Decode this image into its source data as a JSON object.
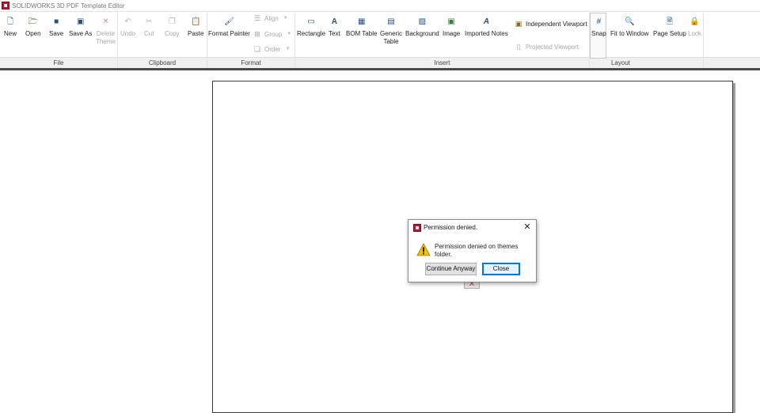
{
  "window": {
    "title": "SOLIDWORKS 3D PDF Template Editor"
  },
  "ribbon": {
    "file": {
      "label": "File",
      "new": "New",
      "open": "Open",
      "save": "Save",
      "save_as": "Save As",
      "delete_theme_line1": "Delete",
      "delete_theme_line2": "Theme"
    },
    "clipboard": {
      "label": "Clipboard",
      "undo": "Undo",
      "cut": "Cut",
      "copy": "Copy",
      "paste": "Paste"
    },
    "format": {
      "label": "Format",
      "format_painter": "Format Painter",
      "align": "Align",
      "group": "Group",
      "order": "Order"
    },
    "insert": {
      "label": "Insert",
      "rectangle": "Rectangle",
      "text": "Text",
      "bom_table": "BOM Table",
      "generic_table_line1": "Generic",
      "generic_table_line2": "Table",
      "background": "Background",
      "image": "Image",
      "imported_notes": "Imported Notes",
      "independent_viewport": "Independent Viewport",
      "projected_viewport": "Projected Viewport"
    },
    "layout": {
      "label": "Layout",
      "snap": "Snap",
      "fit_to_window": "Fit to Window",
      "page_setup": "Page Setup",
      "lock": "Lock"
    }
  },
  "dialog": {
    "title": "Permission denied.",
    "message": "Permission denied on themes folder.",
    "continue_button": "Continue Anyway",
    "close_button": "Close"
  },
  "colors": {
    "accent": "#0078d7",
    "app_red": "#c8102e",
    "warning_yellow": "#f2c200"
  }
}
